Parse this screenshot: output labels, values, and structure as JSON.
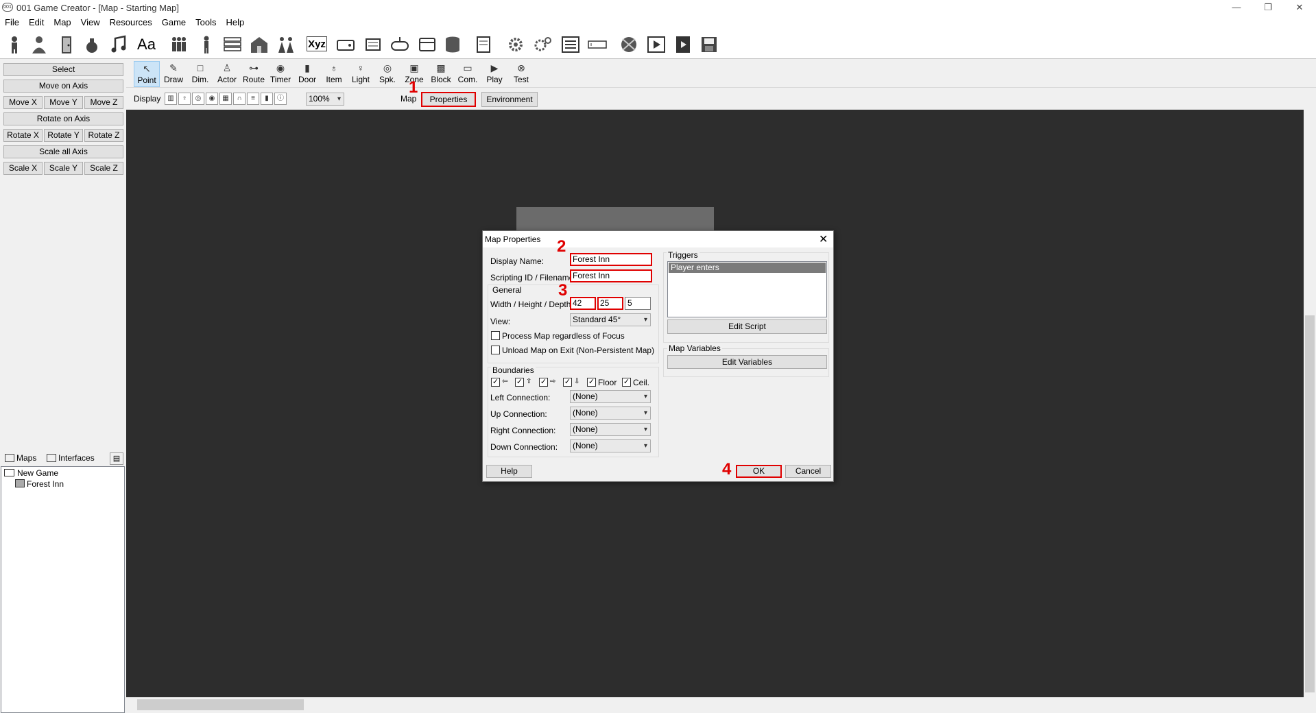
{
  "window": {
    "app_icon_text": "001",
    "title": "001 Game Creator - [Map - Starting Map]",
    "minimize": "—",
    "restore": "❐",
    "close": "✕"
  },
  "menu": [
    "File",
    "Edit",
    "Map",
    "View",
    "Resources",
    "Game",
    "Tools",
    "Help"
  ],
  "main_toolbar": {
    "icons": [
      "actor-icon",
      "character-icon",
      "door-icon",
      "item-bag-icon",
      "music-icon",
      "font-icon",
      "group-icon",
      "person-icon",
      "list-icon",
      "building-icon",
      "fighters-icon",
      "xyz-icon",
      "drive-icon",
      "scroll-icon",
      "gamepad-icon",
      "panel-icon",
      "database-icon",
      "book-icon",
      "gear-icon",
      "gears-icon",
      "settings-list-icon",
      "input-icon",
      "globe-icon",
      "play-icon",
      "run-icon",
      "save-icon"
    ],
    "xyz_label": "Xyz",
    "font_label": "Aa"
  },
  "left_panel": {
    "select": "Select",
    "move_axis": "Move on Axis",
    "move_x": "Move X",
    "move_y": "Move Y",
    "move_z": "Move Z",
    "rotate_axis": "Rotate on Axis",
    "rotate_x": "Rotate X",
    "rotate_y": "Rotate Y",
    "rotate_z": "Rotate Z",
    "scale_all": "Scale all Axis",
    "scale_x": "Scale X",
    "scale_y": "Scale Y",
    "scale_z": "Scale Z",
    "tabs": {
      "maps": "Maps",
      "interfaces": "Interfaces"
    },
    "tree": {
      "root": "New Game",
      "child": "Forest Inn"
    }
  },
  "tools": [
    "Point",
    "Draw",
    "Dim.",
    "Actor",
    "Route",
    "Timer",
    "Door",
    "Item",
    "Light",
    "Spk.",
    "Zone",
    "Block",
    "Com.",
    "Play",
    "Test"
  ],
  "display_bar": {
    "label": "Display",
    "zoom": "100%",
    "map_label": "Map",
    "properties": "Properties",
    "environment": "Environment"
  },
  "annotations": {
    "a1": "1",
    "a2": "2",
    "a3": "3",
    "a4": "4"
  },
  "dialog": {
    "title": "Map Properties",
    "display_name_label": "Display Name:",
    "display_name": "Forest Inn",
    "scripting_label": "Scripting ID / Filename:",
    "scripting_id": "Forest Inn",
    "general_label": "General",
    "dims_label": "Width / Height / Depth:",
    "width": "42",
    "height": "25",
    "depth": "5",
    "view_label": "View:",
    "view": "Standard 45°",
    "process_focus": "Process Map regardless of Focus",
    "unload_exit": "Unload Map on Exit (Non-Persistent Map)",
    "boundaries_label": "Boundaries",
    "floor": "Floor",
    "ceil": "Ceil.",
    "left_conn_label": "Left Connection:",
    "up_conn_label": "Up Connection:",
    "right_conn_label": "Right Connection:",
    "down_conn_label": "Down Connection:",
    "conn_value": "(None)",
    "triggers_label": "Triggers",
    "trigger_item": "Player enters",
    "edit_script": "Edit Script",
    "map_vars_label": "Map Variables",
    "edit_vars": "Edit Variables",
    "help": "Help",
    "ok": "OK",
    "cancel": "Cancel"
  },
  "colors": {
    "annotation": "#e00000",
    "viewport": "#2d2d2d"
  }
}
